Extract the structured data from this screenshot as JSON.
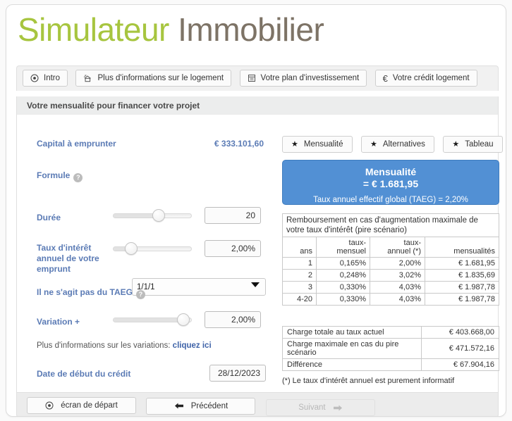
{
  "header": {
    "title_part1": "Simulateur",
    "title_part2": "Immobilier",
    "color_green": "#a7c53f",
    "color_brown": "#7d7366"
  },
  "tabs": [
    {
      "label": "Intro",
      "icon": "target-circle-icon"
    },
    {
      "label": "Plus d'informations sur le logement",
      "icon": "house-icon"
    },
    {
      "label": "Votre plan d'investissement",
      "icon": "document-icon"
    },
    {
      "label": "Votre crédit logement",
      "icon": "euro-icon"
    }
  ],
  "section": {
    "title": "Votre mensualité pour financer votre projet"
  },
  "form": {
    "capital_label": "Capital à emprunter",
    "capital_value": "€ 333.101,60",
    "formule_label": "Formule",
    "formule_value": "1/1/1",
    "formule_options": [
      "1/1/1"
    ],
    "duree_label": "Durée",
    "duree_value": "20",
    "duree_slider_pct": 60,
    "taux_label": "Taux d'intérêt annuel de votre emprunt",
    "taux_value": "2,00%",
    "taux_slider_pct": 18,
    "taeg_note": "Il ne s'agit pas du TAEG",
    "variation_label": "Variation +",
    "variation_value": "2,00%",
    "variation_slider_pct": 97,
    "variations_note_prefix": "Plus d'informations sur les variations: ",
    "variations_note_link": "cliquez ici",
    "date_label": "Date de début du crédit",
    "date_value": "28/12/2023",
    "help_glyph": "?"
  },
  "result": {
    "view_buttons": [
      {
        "label": "Mensualité",
        "icon": "star-icon"
      },
      {
        "label": "Alternatives",
        "icon": "star-icon"
      },
      {
        "label": "Tableau",
        "icon": "star-icon"
      }
    ],
    "box_title": "Mensualité",
    "box_amount": "= € 1.681,95",
    "box_taeg": "Taux annuel effectif global (TAEG) = 2,20%",
    "box_color": "#5290d4"
  },
  "scenario_table": {
    "caption": "Remboursement en cas d'augmentation maximale de votre taux d'intérêt (pire scénario)",
    "columns": [
      "ans",
      "taux-mensuel",
      "taux-annuel (*)",
      "mensualités"
    ],
    "columns_wrapped": [
      [
        "",
        "ans"
      ],
      [
        "taux-",
        "mensuel"
      ],
      [
        "taux-",
        "annuel (*)"
      ],
      [
        "",
        "mensualités"
      ]
    ],
    "rows": [
      [
        "1",
        "0,165%",
        "2,00%",
        "€ 1.681,95"
      ],
      [
        "2",
        "0,248%",
        "3,02%",
        "€ 1.835,69"
      ],
      [
        "3",
        "0,330%",
        "4,03%",
        "€ 1.987,78"
      ],
      [
        "4-20",
        "0,330%",
        "4,03%",
        "€ 1.987,78"
      ]
    ]
  },
  "totals_table": {
    "rows": [
      {
        "label": "Charge totale au taux actuel",
        "value": "€ 403.668,00"
      },
      {
        "label": "Charge maximale en cas du pire scénario",
        "value": "€ 471.572,16"
      },
      {
        "label": "Différence",
        "value": "€ 67.904,16"
      }
    ]
  },
  "footnote": "(*) Le taux d'intérêt annuel est purement informatif",
  "footer": {
    "home_label": "écran de départ",
    "prev_label": "Précédent",
    "next_label": "Suivant",
    "next_disabled": true
  }
}
